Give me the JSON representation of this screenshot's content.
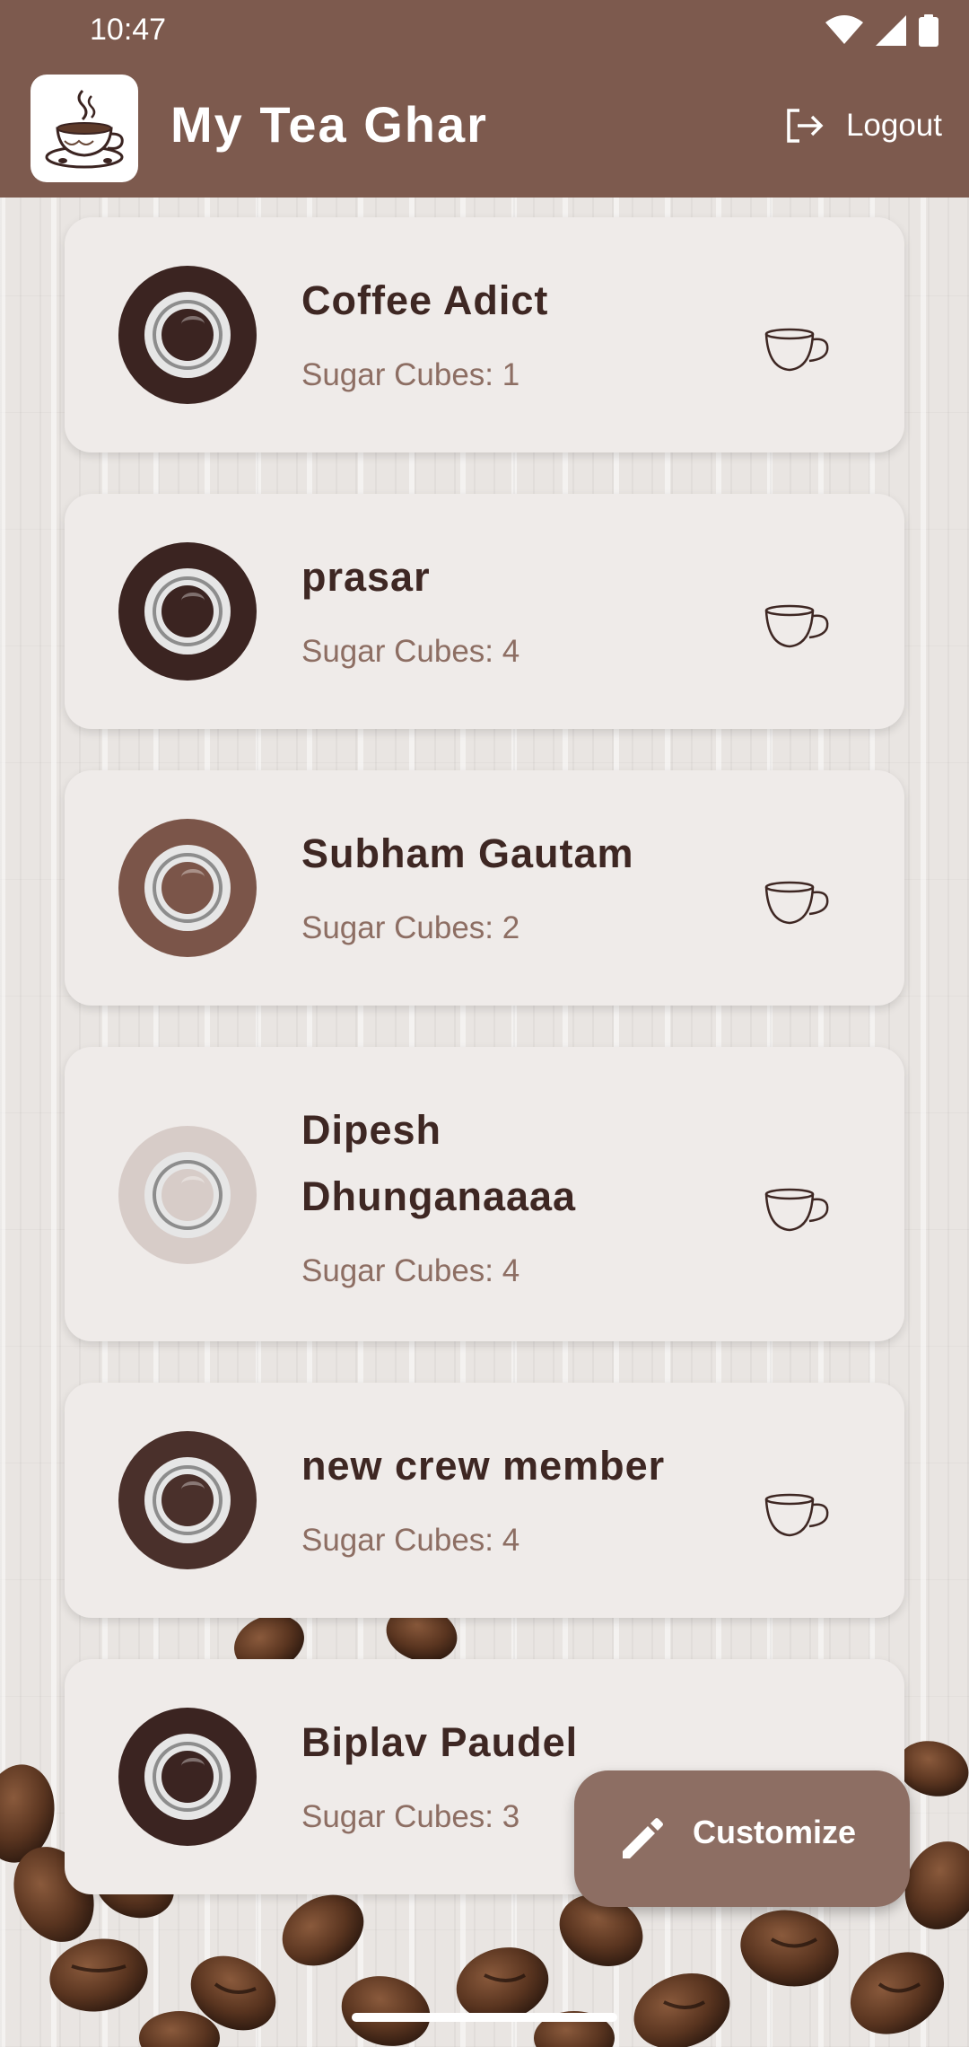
{
  "status_bar": {
    "time": "10:47"
  },
  "app_bar": {
    "title": "My Tea Ghar",
    "logout_label": "Logout"
  },
  "crew": [
    {
      "name": "Coffee Adict",
      "sugar": "Sugar Cubes: 1",
      "color": "#3b2421"
    },
    {
      "name": "prasar",
      "sugar": "Sugar Cubes: 4",
      "color": "#3b2421"
    },
    {
      "name": "Subham Gautam",
      "sugar": "Sugar Cubes: 2",
      "color": "#7b5549"
    },
    {
      "name_line1": "Dipesh",
      "name_line2": "Dhunganaaaa",
      "sugar": "Sugar Cubes: 4",
      "color": "#d7ccc8"
    },
    {
      "name": "new crew member",
      "sugar": "Sugar Cubes: 4",
      "color": "#4a302b"
    },
    {
      "name": "Biplav Paudel",
      "sugar": "Sugar Cubes: 3",
      "color": "#3b2421"
    }
  ],
  "fab": {
    "label": "Customize"
  },
  "colors": {
    "primary": "#7d5a4e",
    "fab": "#8d6e63",
    "text_dark": "#3e2723",
    "text_muted": "#8d6e63"
  },
  "icons": [
    "wifi-icon",
    "signal-icon",
    "battery-icon",
    "tea-logo-icon",
    "logout-icon",
    "coffee-cup-icon",
    "cup-outline-icon",
    "pencil-icon"
  ]
}
